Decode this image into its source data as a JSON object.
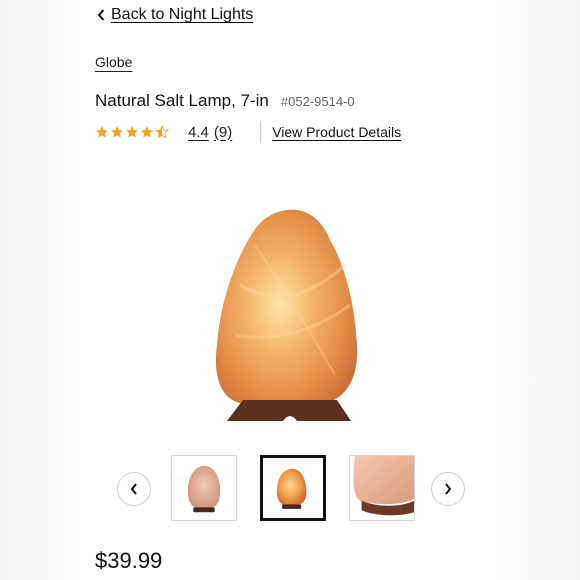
{
  "nav": {
    "back_label": "Back to Night Lights"
  },
  "product": {
    "brand": "Globe",
    "title": "Natural Salt Lamp, 7-in",
    "sku": "#052-9514-0",
    "rating": {
      "value": "4.4",
      "count": "(9)",
      "stars": 4.4
    },
    "details_label": "View Product Details",
    "price": "$39.99"
  },
  "gallery": {
    "prev_icon": "chevron-left-icon",
    "next_icon": "chevron-right-icon",
    "thumbnails": [
      {
        "name": "salt-lamp-unlit",
        "active": false
      },
      {
        "name": "salt-lamp-lit",
        "active": true
      },
      {
        "name": "salt-lamp-closeup",
        "active": false
      }
    ]
  },
  "colors": {
    "star": "#f0a41c",
    "text": "#111111",
    "border": "#cfcfcf"
  }
}
